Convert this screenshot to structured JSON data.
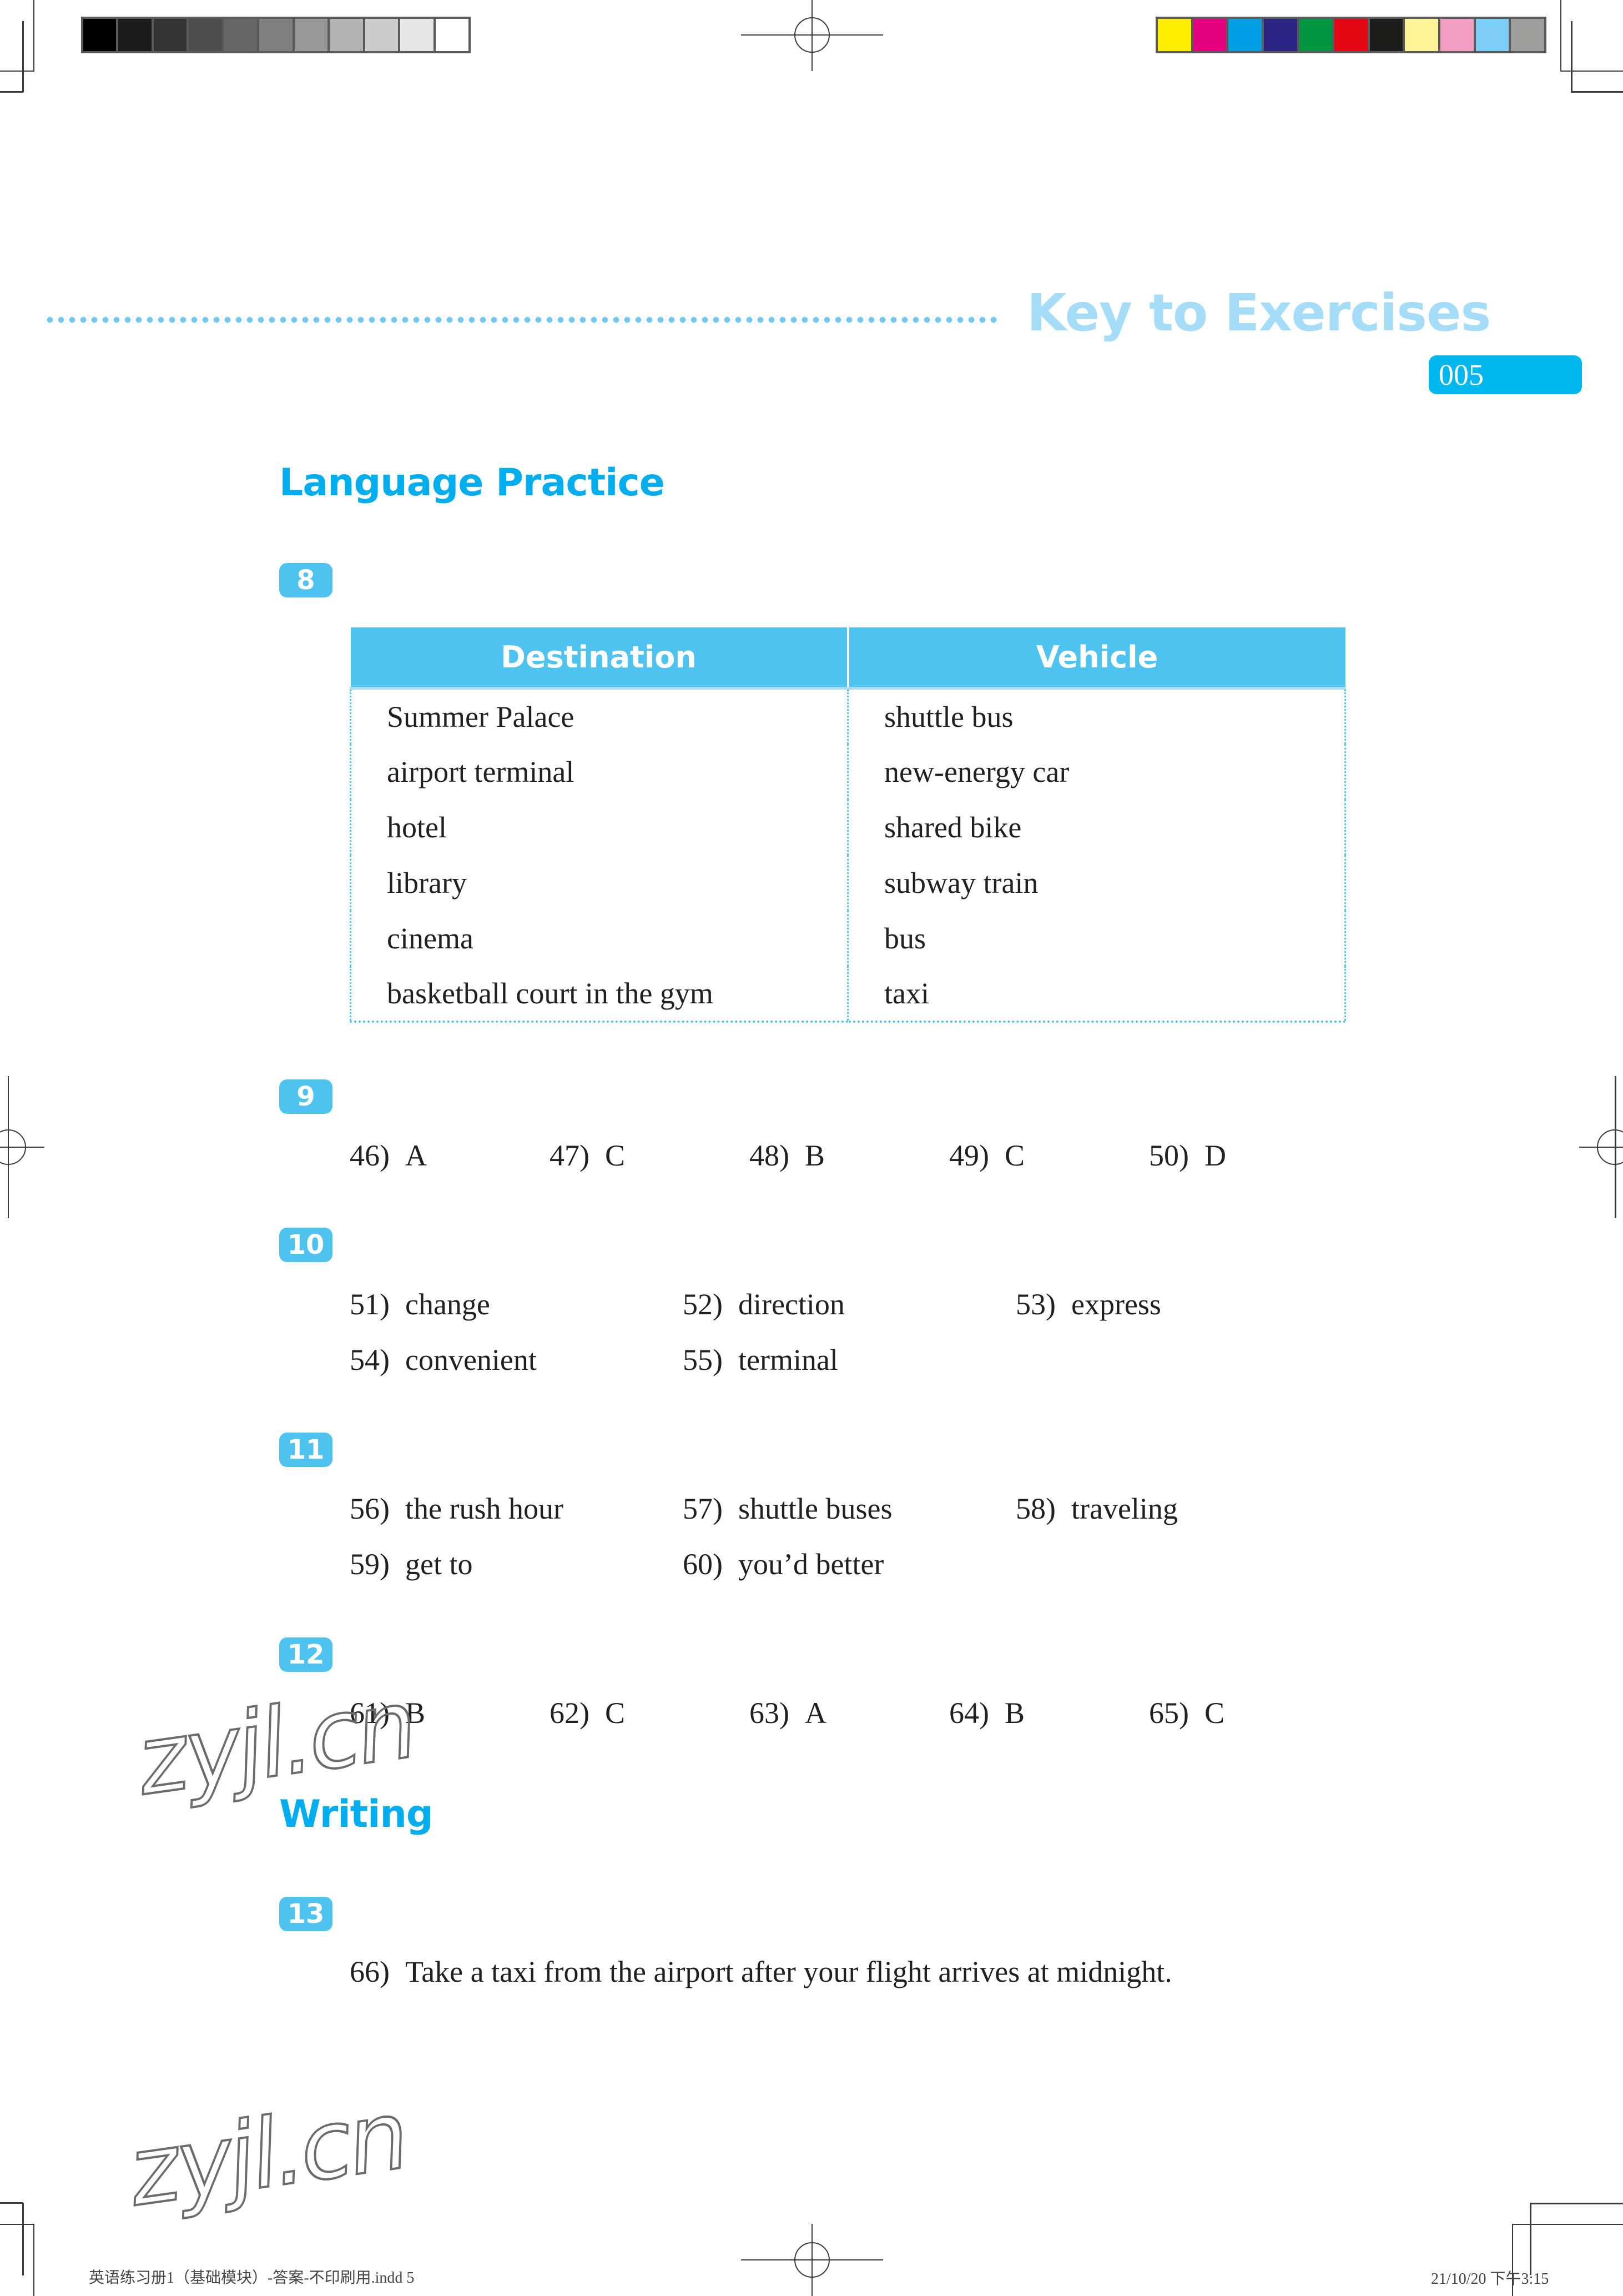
{
  "print_marks": {
    "grayscale_swatches": [
      "#000000",
      "#1a1a1a",
      "#333333",
      "#4d4d4d",
      "#666666",
      "#808080",
      "#999999",
      "#b3b3b3",
      "#cccccc",
      "#e6e6e6",
      "#ffffff"
    ],
    "color_swatches": [
      "#ffed00",
      "#e4007f",
      "#009fe3",
      "#2b2483",
      "#009540",
      "#e30613",
      "#1d1d1b",
      "#fff397",
      "#f39fc3",
      "#7bcdf6",
      "#9d9d9c"
    ]
  },
  "header": {
    "title": "Key to Exercises",
    "page_number": "005",
    "accent_color": "#00aeef"
  },
  "sections": {
    "language_practice": {
      "heading": "Language Practice",
      "ex8": {
        "badge": "8",
        "table": {
          "headers": [
            "Destination",
            "Vehicle"
          ],
          "rows": [
            [
              "Summer Palace",
              "shuttle bus"
            ],
            [
              "airport terminal",
              "new-energy car"
            ],
            [
              "hotel",
              "shared bike"
            ],
            [
              "library",
              "subway train"
            ],
            [
              "cinema",
              "bus"
            ],
            [
              "basketball court in the gym",
              "taxi"
            ]
          ]
        }
      },
      "ex9": {
        "badge": "9",
        "answers": [
          {
            "num": "46)",
            "text": "A"
          },
          {
            "num": "47)",
            "text": "C"
          },
          {
            "num": "48)",
            "text": "B"
          },
          {
            "num": "49)",
            "text": "C"
          },
          {
            "num": "50)",
            "text": "D"
          }
        ]
      },
      "ex10": {
        "badge": "10",
        "answers": [
          {
            "num": "51)",
            "text": "change"
          },
          {
            "num": "52)",
            "text": "direction"
          },
          {
            "num": "53)",
            "text": "express"
          },
          {
            "num": "54)",
            "text": "convenient"
          },
          {
            "num": "55)",
            "text": "terminal"
          }
        ]
      },
      "ex11": {
        "badge": "11",
        "answers": [
          {
            "num": "56)",
            "text": "the rush hour"
          },
          {
            "num": "57)",
            "text": "shuttle buses"
          },
          {
            "num": "58)",
            "text": "traveling"
          },
          {
            "num": "59)",
            "text": "get to"
          },
          {
            "num": "60)",
            "text": "you’d better"
          }
        ]
      },
      "ex12": {
        "badge": "12",
        "answers": [
          {
            "num": "61)",
            "text": "B"
          },
          {
            "num": "62)",
            "text": "C"
          },
          {
            "num": "63)",
            "text": "A"
          },
          {
            "num": "64)",
            "text": "B"
          },
          {
            "num": "65)",
            "text": "C"
          }
        ]
      }
    },
    "writing": {
      "heading": "Writing",
      "ex13": {
        "badge": "13",
        "answers": [
          {
            "num": "66)",
            "text": "Take a taxi from the airport after your flight arrives at midnight."
          }
        ]
      }
    }
  },
  "watermarks": [
    "zyjl.cn",
    "zyjl.cn"
  ],
  "footer": {
    "file_slug": "英语练习册1（基础模块）-答案-不印刷用.indd   5",
    "timestamp": "21/10/20   下午3:15"
  }
}
